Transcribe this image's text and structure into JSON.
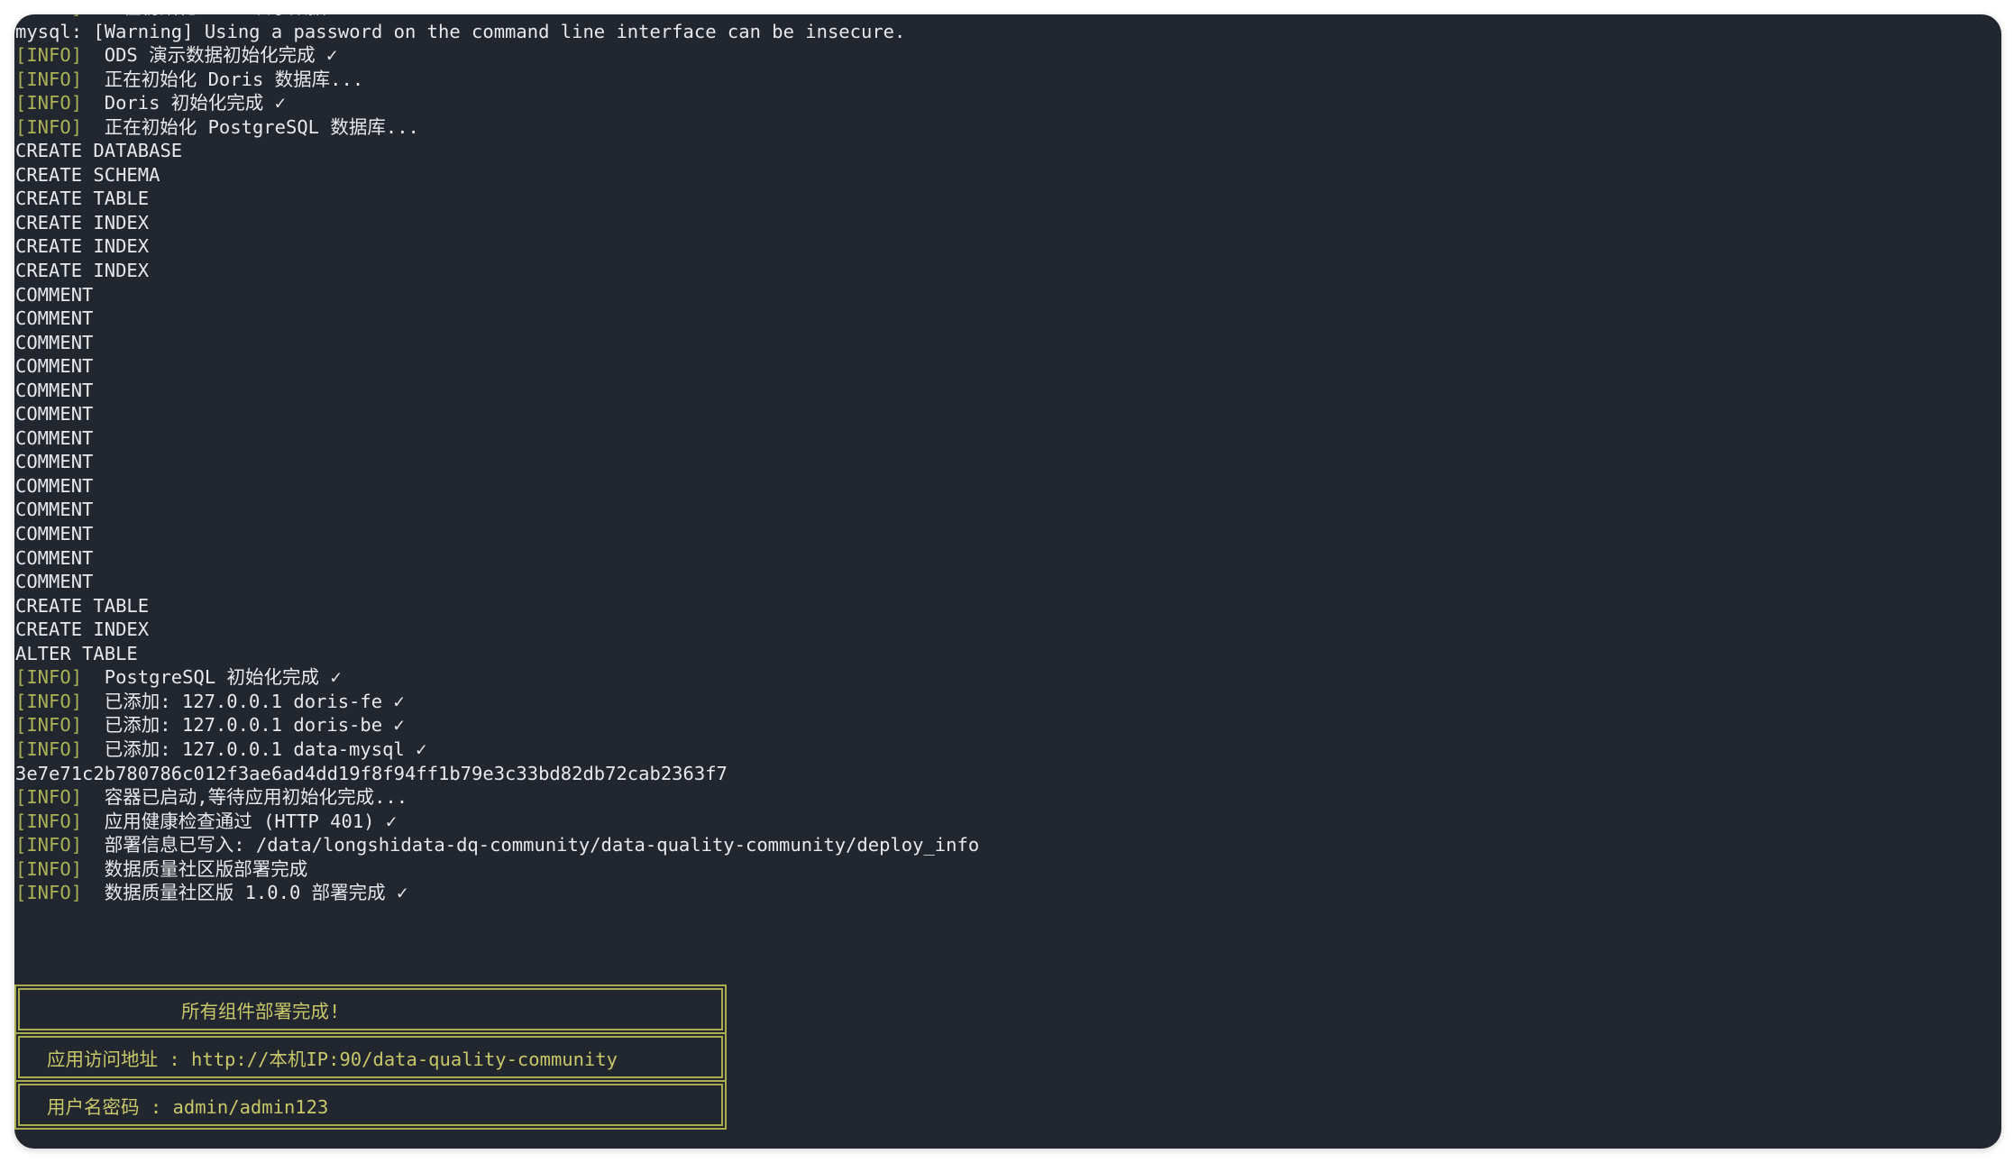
{
  "colors": {
    "terminal_bg": "#22262e",
    "text": "#e7e9ec",
    "info_tag": "#a9b256",
    "banner_text": "#c7c86a",
    "banner_border": "#a9ad4e"
  },
  "terminal": {
    "lines": [
      {
        "tag": "[INFO]",
        "text": "  正在初始化 ODS 演示数据..."
      },
      {
        "tag": "",
        "text": "mysql: [Warning] Using a password on the command line interface can be insecure."
      },
      {
        "tag": "[INFO]",
        "text": "  ODS 演示数据初始化完成 ✓"
      },
      {
        "tag": "[INFO]",
        "text": "  正在初始化 Doris 数据库..."
      },
      {
        "tag": "[INFO]",
        "text": "  Doris 初始化完成 ✓"
      },
      {
        "tag": "[INFO]",
        "text": "  正在初始化 PostgreSQL 数据库..."
      },
      {
        "tag": "",
        "text": "CREATE DATABASE"
      },
      {
        "tag": "",
        "text": "CREATE SCHEMA"
      },
      {
        "tag": "",
        "text": "CREATE TABLE"
      },
      {
        "tag": "",
        "text": "CREATE INDEX"
      },
      {
        "tag": "",
        "text": "CREATE INDEX"
      },
      {
        "tag": "",
        "text": "CREATE INDEX"
      },
      {
        "tag": "",
        "text": "COMMENT"
      },
      {
        "tag": "",
        "text": "COMMENT"
      },
      {
        "tag": "",
        "text": "COMMENT"
      },
      {
        "tag": "",
        "text": "COMMENT"
      },
      {
        "tag": "",
        "text": "COMMENT"
      },
      {
        "tag": "",
        "text": "COMMENT"
      },
      {
        "tag": "",
        "text": "COMMENT"
      },
      {
        "tag": "",
        "text": "COMMENT"
      },
      {
        "tag": "",
        "text": "COMMENT"
      },
      {
        "tag": "",
        "text": "COMMENT"
      },
      {
        "tag": "",
        "text": "COMMENT"
      },
      {
        "tag": "",
        "text": "COMMENT"
      },
      {
        "tag": "",
        "text": "COMMENT"
      },
      {
        "tag": "",
        "text": "CREATE TABLE"
      },
      {
        "tag": "",
        "text": "CREATE INDEX"
      },
      {
        "tag": "",
        "text": "ALTER TABLE"
      },
      {
        "tag": "[INFO]",
        "text": "  PostgreSQL 初始化完成 ✓"
      },
      {
        "tag": "[INFO]",
        "text": "  已添加: 127.0.0.1 doris-fe ✓"
      },
      {
        "tag": "[INFO]",
        "text": "  已添加: 127.0.0.1 doris-be ✓"
      },
      {
        "tag": "[INFO]",
        "text": "  已添加: 127.0.0.1 data-mysql ✓"
      },
      {
        "tag": "",
        "text": "3e7e71c2b780786c012f3ae6ad4dd19f8f94ff1b79e3c33bd82db72cab2363f7"
      },
      {
        "tag": "[INFO]",
        "text": "  容器已启动,等待应用初始化完成..."
      },
      {
        "tag": "[INFO]",
        "text": "  应用健康检查通过 (HTTP 401) ✓"
      },
      {
        "tag": "[INFO]",
        "text": "  部署信息已写入: /data/longshidata-dq-community/data-quality-community/deploy_info"
      },
      {
        "tag": "[INFO]",
        "text": "  数据质量社区版部署完成"
      },
      {
        "tag": "[INFO]",
        "text": "  数据质量社区版 1.0.0 部署完成 ✓"
      }
    ]
  },
  "banner": {
    "title": "所有组件部署完成!",
    "url_line": "应用访问地址 : http://本机IP:90/data-quality-community",
    "cred_line": "用户名密码 : admin/admin123"
  }
}
